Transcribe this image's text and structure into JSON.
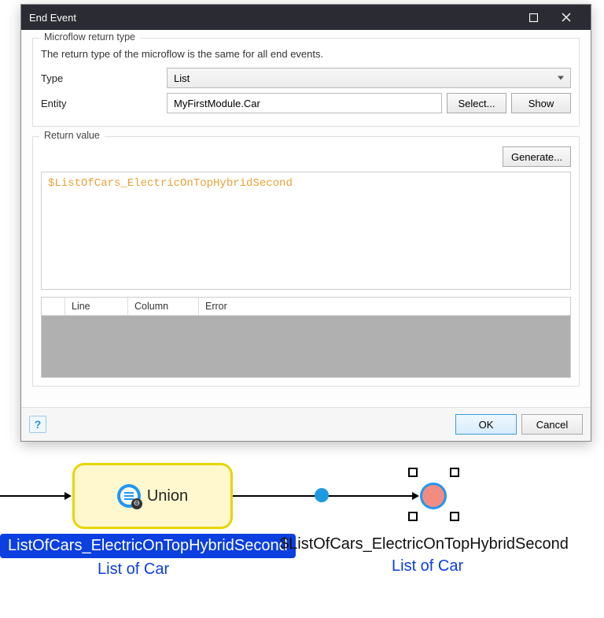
{
  "dialog": {
    "title": "End Event",
    "section_microflow": {
      "legend": "Microflow return type",
      "hint": "The return type of the microflow is the same for all end events.",
      "type_label": "Type",
      "type_value": "List",
      "entity_label": "Entity",
      "entity_value": "MyFirstModule.Car",
      "select_btn": "Select...",
      "show_btn": "Show"
    },
    "section_return": {
      "legend": "Return value",
      "generate_btn": "Generate...",
      "expression": "$ListOfCars_ElectricOnTopHybridSecond",
      "errors": {
        "col_line": "Line",
        "col_column": "Column",
        "col_error": "Error"
      }
    },
    "footer": {
      "ok": "OK",
      "cancel": "Cancel"
    }
  },
  "canvas": {
    "union_label": "Union",
    "union_var": "ListOfCars_ElectricOnTopHybridSecond",
    "union_type": "List of Car",
    "end_var": "$ListOfCars_ElectricOnTopHybridSecond",
    "end_type": "List of Car"
  }
}
